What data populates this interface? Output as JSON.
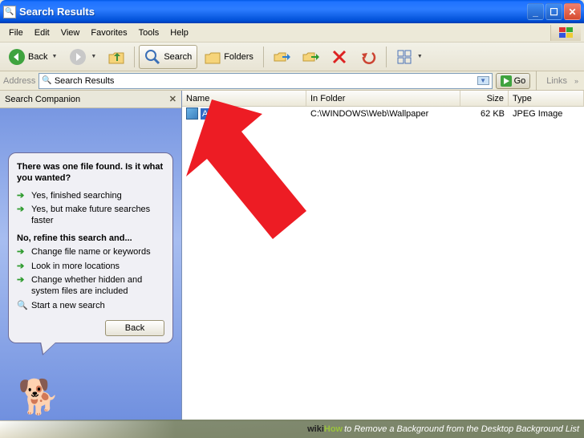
{
  "titlebar": {
    "title": "Search Results"
  },
  "menu": {
    "file": "File",
    "edit": "Edit",
    "view": "View",
    "favorites": "Favorites",
    "tools": "Tools",
    "help": "Help"
  },
  "toolbar": {
    "back": "Back",
    "search": "Search",
    "folders": "Folders"
  },
  "address": {
    "label": "Address",
    "value": "Search Results",
    "go": "Go",
    "links": "Links"
  },
  "panel": {
    "title": "Search Companion",
    "question": "There was one file found.  Is it what you wanted?",
    "opt1": "Yes, finished searching",
    "opt2": "Yes, but make future searches faster",
    "refine_head": "No, refine this search and...",
    "opt3": "Change file name or keywords",
    "opt4": "Look in more locations",
    "opt5": "Change whether hidden and system files are included",
    "opt6": "Start a new search",
    "back": "Back"
  },
  "columns": {
    "name": "Name",
    "folder": "In Folder",
    "size": "Size",
    "type": "Type"
  },
  "rows": [
    {
      "name": "Ascent",
      "folder": "C:\\WINDOWS\\Web\\Wallpaper",
      "size": "62 KB",
      "type": "JPEG Image"
    }
  ],
  "watermark": {
    "brand_wiki": "wiki",
    "brand_how": "How",
    "text": " to Remove a Background from the Desktop Background List"
  }
}
